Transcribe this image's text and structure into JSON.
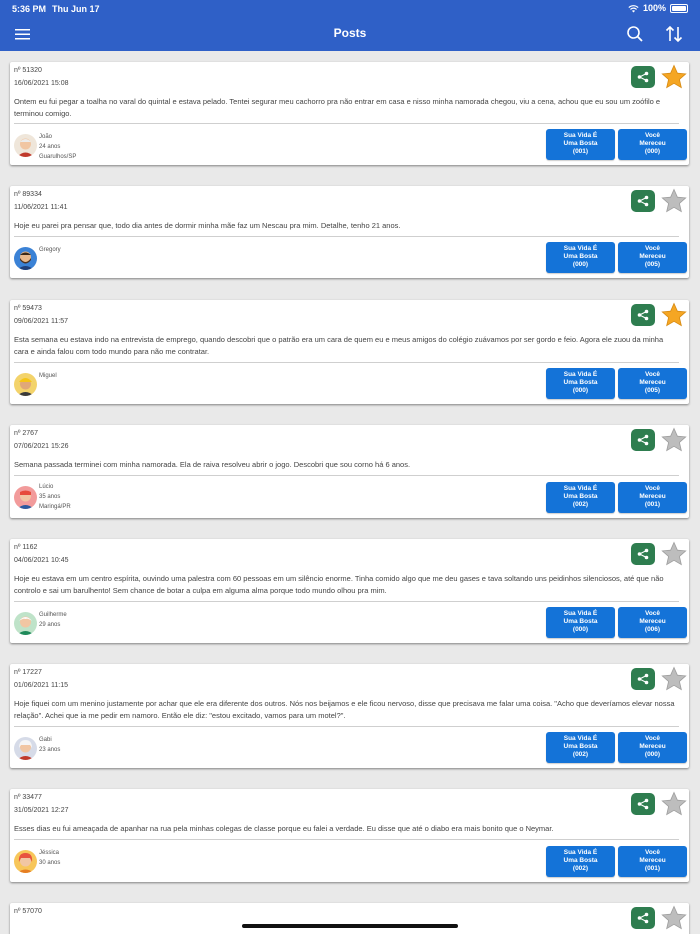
{
  "status_bar": {
    "time": "5:36 PM",
    "date": "Thu Jun 17",
    "battery": "100%"
  },
  "nav": {
    "title": "Posts",
    "menu_icon": "hamburger-menu-icon",
    "search_icon": "search-icon",
    "sort_icon": "sort-arrows-icon"
  },
  "colors": {
    "nav_bg": "#2f60c7",
    "button_bg": "#1473d8",
    "share_bg": "#2e7d4f",
    "star_active": "#f5a623",
    "star_inactive": "#bdbdbd"
  },
  "posts": [
    {
      "number": "nº 51320",
      "date": "16/06/2021 15:08",
      "text": "Ontem eu fui pegar a toalha no varal do quintal e estava pelado. Tentei segurar meu cachorro pra não entrar em casa e nisso minha namorada chegou, viu a cena, achou que eu sou um zoófilo e terminou comigo.",
      "user": "João",
      "age": "24 anos",
      "location": "Guarulhos/SP",
      "starred": true,
      "btn1_l1": "Sua Vida É",
      "btn1_l2": "Uma Bosta",
      "btn1_count": "(001)",
      "btn2_l1": "Você",
      "btn2_l2": "Mereceu",
      "btn2_count": "(000)"
    },
    {
      "number": "nº 89334",
      "date": "11/06/2021 11:41",
      "text": "Hoje eu parei pra pensar que, todo dia antes de dormir minha mãe faz um Nescau pra mim. Detalhe, tenho 21 anos.",
      "user": "Gregory",
      "age": "",
      "location": "",
      "starred": false,
      "btn1_l1": "Sua Vida É",
      "btn1_l2": "Uma Bosta",
      "btn1_count": "(000)",
      "btn2_l1": "Você",
      "btn2_l2": "Mereceu",
      "btn2_count": "(005)"
    },
    {
      "number": "nº 59473",
      "date": "09/06/2021 11:57",
      "text": "Esta semana eu estava indo na entrevista de emprego, quando descobri que o patrão era um cara de quem eu e meus amigos do colégio zuávamos por ser gordo e feio. Agora ele zuou da minha cara e ainda falou com todo mundo para não me contratar.",
      "user": "Miguel",
      "age": "",
      "location": "",
      "starred": true,
      "btn1_l1": "Sua Vida É",
      "btn1_l2": "Uma Bosta",
      "btn1_count": "(000)",
      "btn2_l1": "Você",
      "btn2_l2": "Mereceu",
      "btn2_count": "(005)"
    },
    {
      "number": "nº 2767",
      "date": "07/06/2021 15:26",
      "text": "Semana passada terminei com minha namorada. Ela de raiva resolveu abrir o jogo. Descobri que sou corno há 6 anos.",
      "user": "Lúcio",
      "age": "35 anos",
      "location": "Maringá/PR",
      "starred": false,
      "btn1_l1": "Sua Vida É",
      "btn1_l2": "Uma Bosta",
      "btn1_count": "(002)",
      "btn2_l1": "Você",
      "btn2_l2": "Mereceu",
      "btn2_count": "(001)"
    },
    {
      "number": "nº 1162",
      "date": "04/06/2021 10:45",
      "text": "Hoje eu estava em um centro espírita, ouvindo uma palestra com 60 pessoas em um silêncio enorme. Tinha comido algo que me deu gases e tava soltando uns peidinhos silenciosos, até que não controlo e sai um barulhento! Sem chance de botar a culpa em alguma alma porque todo mundo olhou pra mim.",
      "user": "Guilherme",
      "age": "29 anos",
      "location": "",
      "starred": false,
      "btn1_l1": "Sua Vida É",
      "btn1_l2": "Uma Bosta",
      "btn1_count": "(000)",
      "btn2_l1": "Você",
      "btn2_l2": "Mereceu",
      "btn2_count": "(006)"
    },
    {
      "number": "nº 17227",
      "date": "01/06/2021 11:15",
      "text": "Hoje fiquei com um menino justamente por achar que ele era diferente dos outros. Nós nos beijamos e ele ficou nervoso, disse que precisava me falar uma coisa. \"Acho que deveríamos elevar nossa relação\". Achei que ia me pedir em namoro. Então ele diz: \"estou excitado, vamos para um motel?\".",
      "user": "Gabi",
      "age": "23 anos",
      "location": "",
      "starred": false,
      "btn1_l1": "Sua Vida É",
      "btn1_l2": "Uma Bosta",
      "btn1_count": "(002)",
      "btn2_l1": "Você",
      "btn2_l2": "Mereceu",
      "btn2_count": "(000)"
    },
    {
      "number": "nº 33477",
      "date": "31/05/2021 12:27",
      "text": "Esses dias eu fui ameaçada de apanhar na rua pela minhas colegas de classe porque eu falei a verdade. Eu disse que até o diabo era mais bonito que o Neymar.",
      "user": "Jéssica",
      "age": "30 anos",
      "location": "",
      "starred": false,
      "btn1_l1": "Sua Vida É",
      "btn1_l2": "Uma Bosta",
      "btn1_count": "(002)",
      "btn2_l1": "Você",
      "btn2_l2": "Mereceu",
      "btn2_count": "(001)"
    },
    {
      "number": "nº 57070",
      "date": "",
      "text": "",
      "user": "",
      "age": "",
      "location": "",
      "starred": false,
      "btn1_l1": "",
      "btn1_l2": "",
      "btn1_count": "",
      "btn2_l1": "",
      "btn2_l2": "",
      "btn2_count": ""
    }
  ]
}
